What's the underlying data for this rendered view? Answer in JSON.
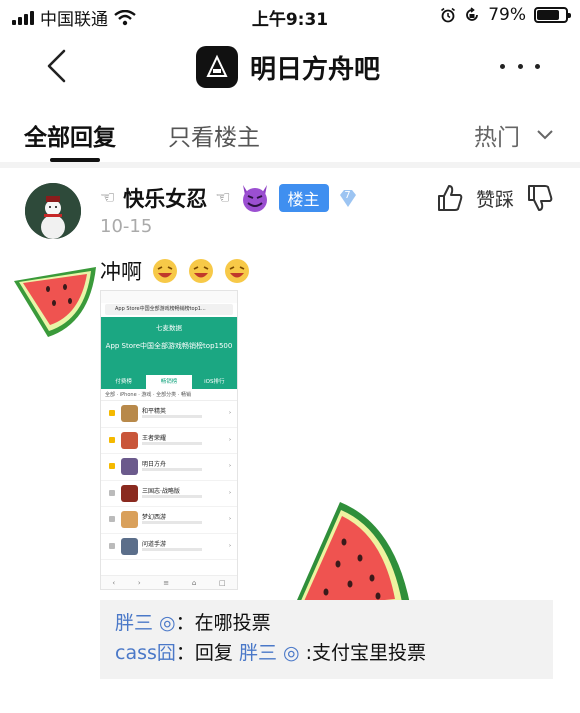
{
  "status_bar": {
    "carrier": "中国联通",
    "time": "上午9:31",
    "battery": "79%",
    "battery_level": 0.79
  },
  "nav": {
    "title": "明日方舟吧"
  },
  "tabs": {
    "all_replies": "全部回复",
    "only_op": "只看楼主",
    "sort": "热门"
  },
  "post": {
    "author_name": "快乐女忍",
    "op_badge": "楼主",
    "level": "7",
    "date": "10-15",
    "vote_label": "赞踩",
    "text": "冲啊"
  },
  "embedded": {
    "url": "App Store中国全部游戏榜畅销榜top1...",
    "header_title": "七麦数据",
    "header_subtitle": "App Store中国全部游戏畅销榜top1500",
    "tabs": [
      "付费榜",
      "畅销榜",
      "iOS排行"
    ],
    "filter": "全部 · iPhone · 游戏 · 全部分类 · 畅销",
    "rows": [
      "和平精英",
      "王者荣耀",
      "明日方舟",
      "三国志·战略版",
      "梦幻西游",
      "问道手游"
    ]
  },
  "replies": [
    {
      "name": "胖三 ◎",
      "sep": "：",
      "text": "在哪投票"
    },
    {
      "name": "cass囧",
      "sep": "：",
      "prefix": "回复 ",
      "mention": "胖三 ◎",
      "text": " :支付宝里投票"
    }
  ]
}
